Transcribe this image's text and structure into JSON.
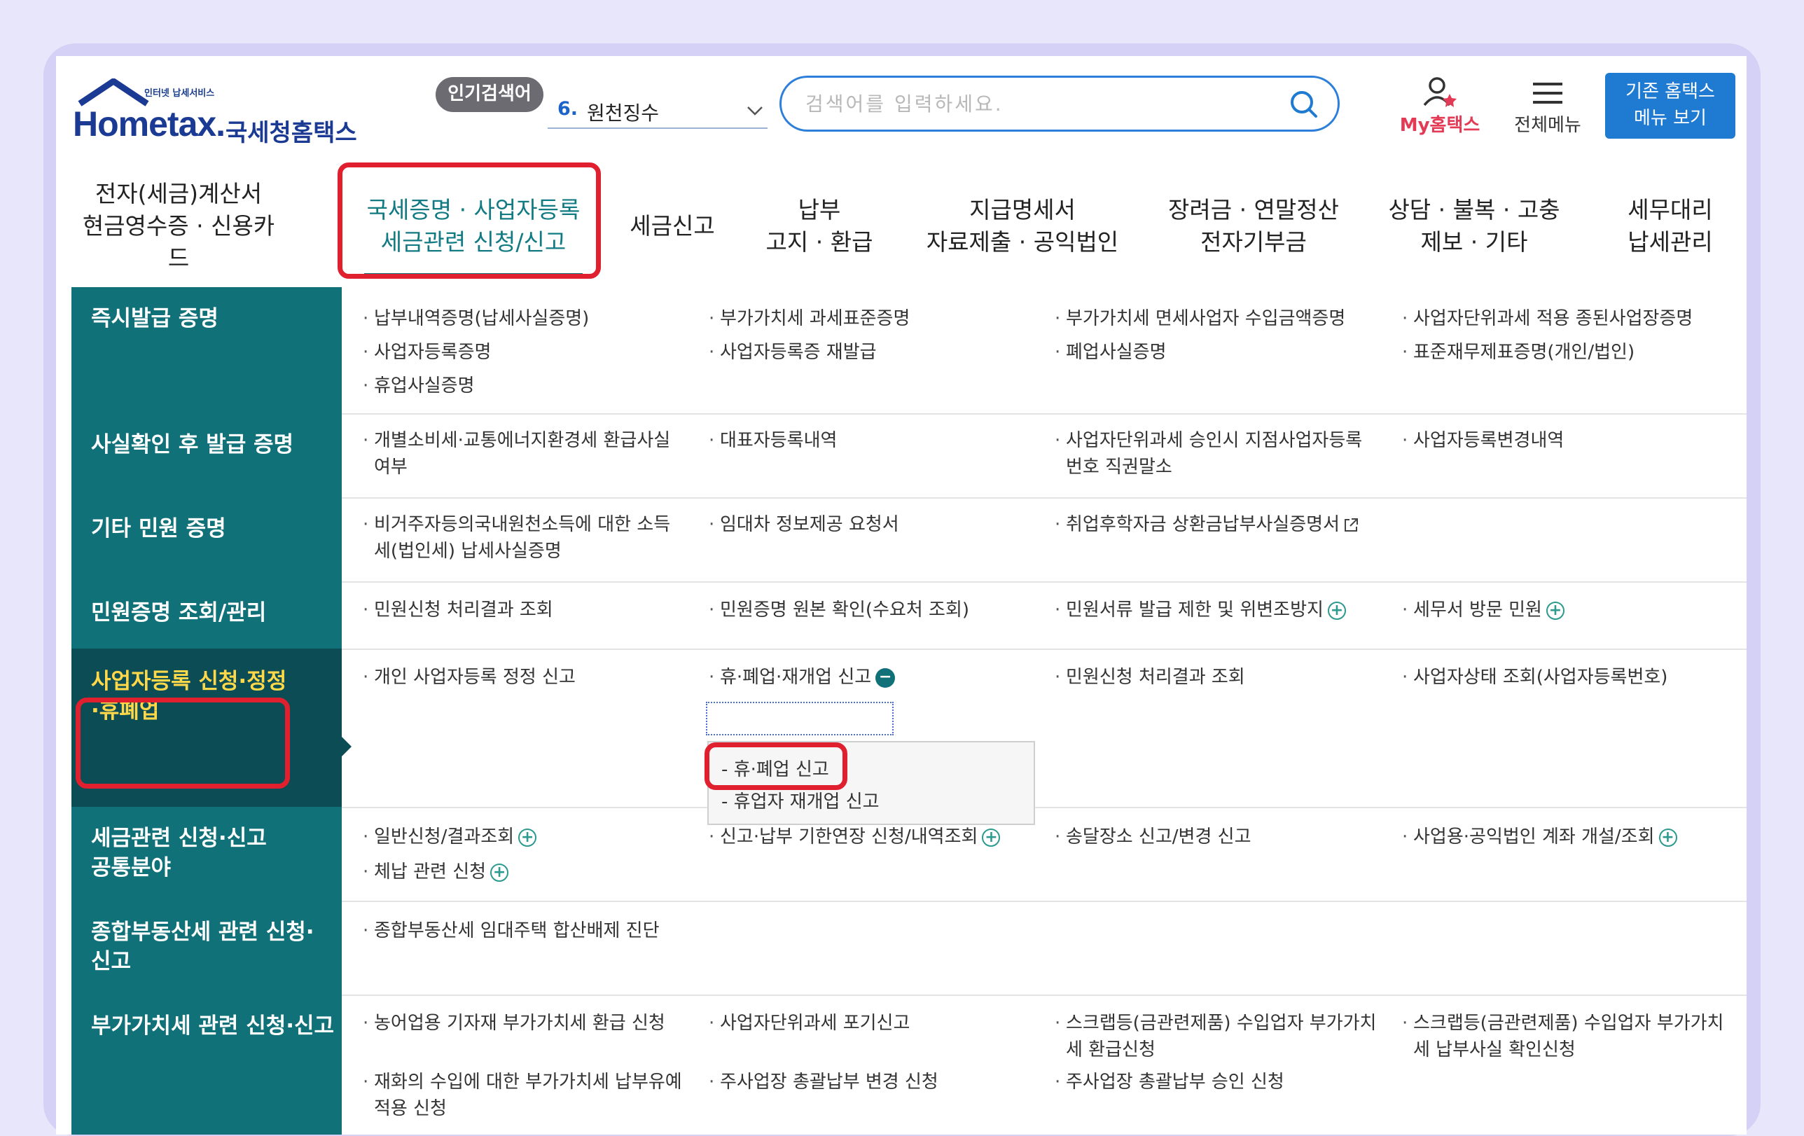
{
  "header": {
    "logo_tagline": "인터넷 납세서비스",
    "logo_main": "Hometax.",
    "logo_sub": "국세청홈택스",
    "popular_badge": "인기검색어",
    "popular_rank": "6.",
    "popular_word": "원천징수",
    "search_placeholder": "검색어를 입력하세요.",
    "my_hometax": "My홈택스",
    "all_menu": "전체메뉴",
    "old_menu_line1": "기존 홈택스",
    "old_menu_line2": "메뉴 보기"
  },
  "gnb": [
    {
      "line1": "전자(세금)계산서",
      "line2": "현금영수증 · 신용카드"
    },
    {
      "line1": "국세증명 · 사업자등록",
      "line2": "세금관련 신청/신고"
    },
    {
      "line1": "세금신고",
      "line2": ""
    },
    {
      "line1": "납부",
      "line2": "고지 · 환급"
    },
    {
      "line1": "지급명세서",
      "line2": "자료제출 · 공익법인"
    },
    {
      "line1": "장려금 · 연말정산",
      "line2": "전자기부금"
    },
    {
      "line1": "상담 · 불복 · 고충",
      "line2": "제보 · 기타"
    },
    {
      "line1": "세무대리",
      "line2": "납세관리"
    }
  ],
  "rows": [
    {
      "category": "즉시발급 증명",
      "items": [
        "납부내역증명(납세사실증명)",
        "부가가치세 과세표준증명",
        "부가가치세 면세사업자 수입금액증명",
        "사업자단위과세 적용 종된사업장증명",
        "사업자등록증명",
        "사업자등록증 재발급",
        "폐업사실증명",
        "표준재무제표증명(개인/법인)",
        "휴업사실증명"
      ]
    },
    {
      "category": "사실확인 후 발급 증명",
      "items": [
        "개별소비세·교통에너지환경세 환급사실 여부",
        "대표자등록내역",
        "사업자단위과세 승인시 지점사업자등록 번호 직권말소",
        "사업자등록변경내역"
      ]
    },
    {
      "category": "기타 민원 증명",
      "items": [
        "비거주자등의국내원천소득에 대한 소득세(법인세) 납세사실증명",
        "임대차 정보제공 요청서",
        "취업후학자금 상환금납부사실증명서"
      ]
    },
    {
      "category": "민원증명 조회/관리",
      "items": [
        "민원신청 처리결과 조회",
        "민원증명 원본 확인(수요처 조회)",
        "민원서류 발급 제한 및 위변조방지",
        "세무서 방문 민원"
      ]
    },
    {
      "category": "사업자등록 신청·정정·휴폐업",
      "items": [
        "개인 사업자등록 정정 신고",
        "휴·폐업·재개업 신고",
        "민원신청 처리결과 조회",
        "사업자상태 조회(사업자등록번호)"
      ],
      "submenu": [
        "휴·폐업 신고",
        "휴업자 재개업 신고"
      ]
    },
    {
      "category_line1": "세금관련 신청·신고",
      "category_line2": "공통분야",
      "items": [
        "일반신청/결과조회",
        "신고·납부 기한연장 신청/내역조회",
        "송달장소 신고/변경 신고",
        "사업용·공익법인 계좌 개설/조회",
        "체납 관련 신청"
      ]
    },
    {
      "category_line1": "종합부동산세 관련 신청·",
      "category_line2": "신고",
      "items": [
        "종합부동산세 임대주택 합산배제 진단"
      ]
    },
    {
      "category": "부가가치세 관련 신청·신고",
      "items": [
        "농어업용 기자재 부가가치세 환급 신청",
        "사업자단위과세 포기신고",
        "스크랩등(금관련제품) 수입업자 부가가치세 환급신청",
        "스크랩등(금관련제품) 수입업자 부가가치세 납부사실 확인신청",
        "재화의 수입에 대한 부가가치세 납부유예 적용 신청",
        "주사업장 총괄납부 변경 신청",
        "주사업장 총괄납부 승인 신청"
      ]
    }
  ],
  "colors": {
    "teal": "#107179",
    "teal_dark": "#0c4d55",
    "highlight_red": "#e01f2f",
    "brand_blue": "#1b3a93",
    "accent_blue": "#1f7bd2"
  }
}
